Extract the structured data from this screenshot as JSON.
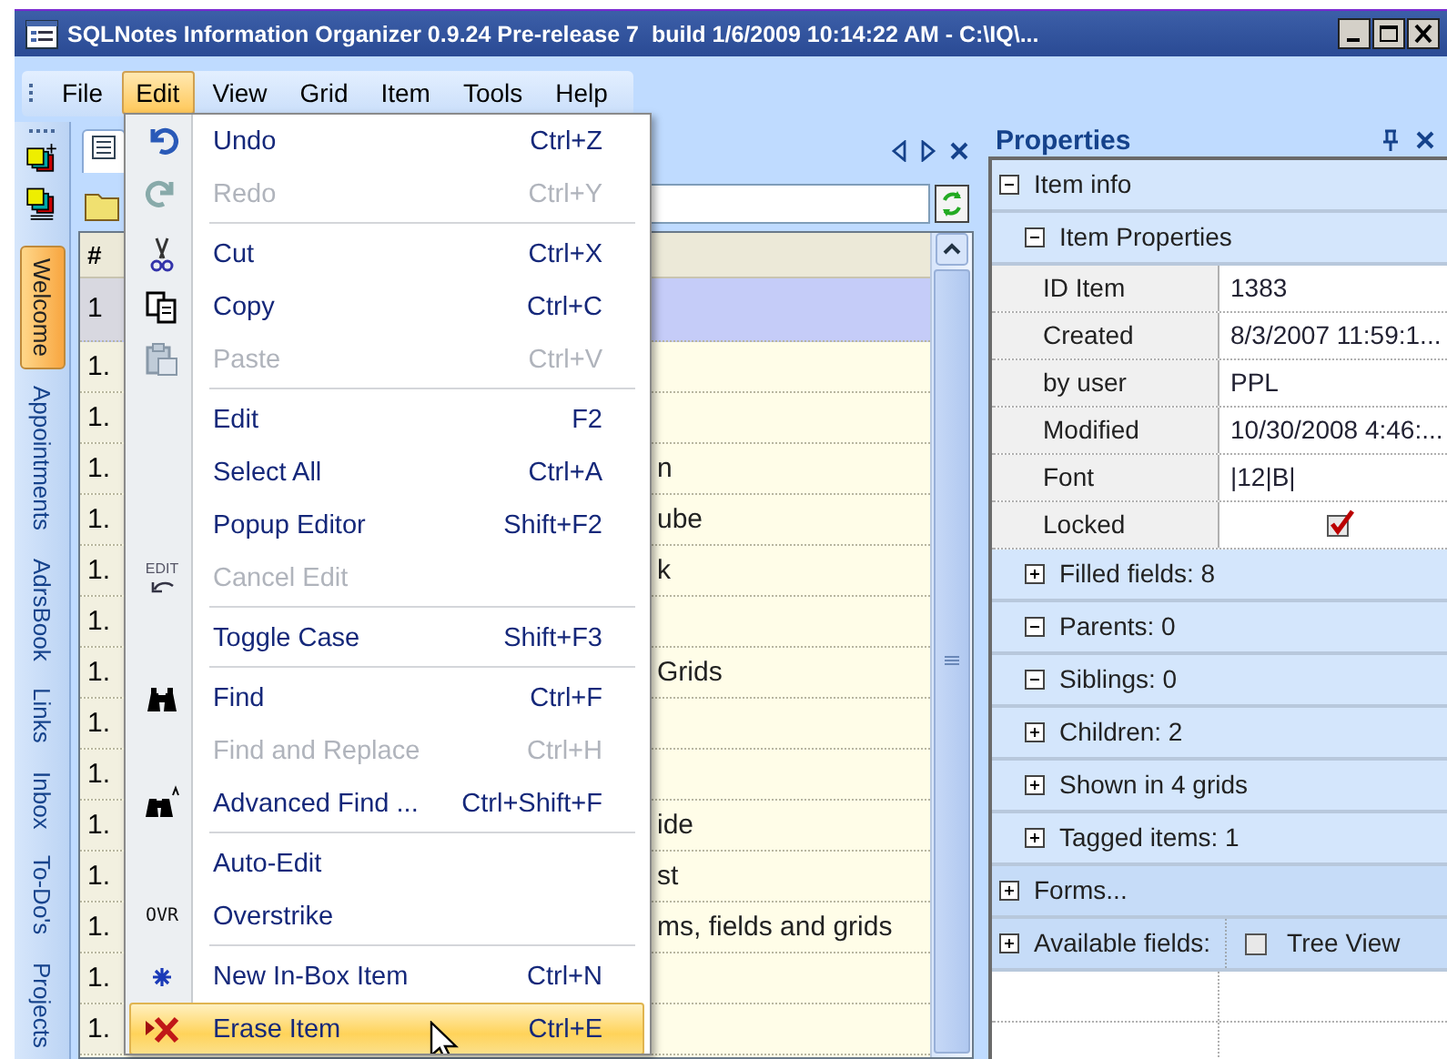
{
  "window": {
    "title": "SQLNotes Information Organizer 0.9.24 Pre-release 7  build 1/6/2009 10:14:22 AM - C:\\IQ\\..."
  },
  "menu_bar": [
    {
      "label": "File",
      "selected": false
    },
    {
      "label": "Edit",
      "selected": true
    },
    {
      "label": "View",
      "selected": false
    },
    {
      "label": "Grid",
      "selected": false
    },
    {
      "label": "Item",
      "selected": false
    },
    {
      "label": "Tools",
      "selected": false
    },
    {
      "label": "Help",
      "selected": false
    }
  ],
  "sidebar": {
    "tabs": [
      {
        "label": "Welcome",
        "selected": true
      },
      {
        "label": "Appointments",
        "selected": false
      },
      {
        "label": "AdrsBook",
        "selected": false
      },
      {
        "label": "Links",
        "selected": false
      },
      {
        "label": "Inbox",
        "selected": false
      },
      {
        "label": "To-Do's",
        "selected": false
      },
      {
        "label": "Projects",
        "selected": false
      }
    ]
  },
  "grid": {
    "columns": [
      "#"
    ],
    "rows": [
      {
        "number": "1",
        "selected": true
      },
      {
        "number": "1.",
        "selected": false
      },
      {
        "number": "1.",
        "selected": false
      },
      {
        "number": "1.",
        "text": "n",
        "selected": false
      },
      {
        "number": "1.",
        "text": "ube",
        "selected": false
      },
      {
        "number": "1.",
        "text": "k",
        "selected": false
      },
      {
        "number": "1.",
        "selected": false
      },
      {
        "number": "1.",
        "text": "Grids",
        "selected": false
      },
      {
        "number": "1.",
        "selected": false
      },
      {
        "number": "1.",
        "selected": false
      },
      {
        "number": "1.",
        "text": "ide",
        "selected": false
      },
      {
        "number": "1.",
        "text": "st",
        "selected": false
      },
      {
        "number": "1.",
        "text": "ms, fields and grids",
        "selected": false
      },
      {
        "number": "1.",
        "selected": false
      },
      {
        "number": "1.",
        "selected": false
      }
    ]
  },
  "edit_menu": {
    "sections": [
      {
        "items": [
          {
            "label": "Undo",
            "shortcut": "Ctrl+Z",
            "disabled": false,
            "selected": false
          },
          {
            "label": "Redo",
            "shortcut": "Ctrl+Y",
            "disabled": true,
            "selected": false
          }
        ]
      },
      {
        "items": [
          {
            "label": "Cut",
            "shortcut": "Ctrl+X",
            "disabled": false,
            "selected": false
          },
          {
            "label": "Copy",
            "shortcut": "Ctrl+C",
            "disabled": false,
            "selected": false
          },
          {
            "label": "Paste",
            "shortcut": "Ctrl+V",
            "disabled": true,
            "selected": false
          }
        ]
      },
      {
        "items": [
          {
            "label": "Edit",
            "shortcut": "F2",
            "disabled": false,
            "selected": false
          },
          {
            "label": "Select All",
            "shortcut": "Ctrl+A",
            "disabled": false,
            "selected": false
          },
          {
            "label": "Popup Editor",
            "shortcut": "Shift+F2",
            "disabled": false,
            "selected": false
          },
          {
            "label": "Cancel Edit",
            "icon_label": "EDIT",
            "disabled": true,
            "selected": false
          }
        ]
      },
      {
        "items": [
          {
            "label": "Toggle Case",
            "shortcut": "Shift+F3",
            "disabled": false,
            "selected": false
          }
        ]
      },
      {
        "items": [
          {
            "label": "Find",
            "shortcut": "Ctrl+F",
            "disabled": false,
            "selected": false
          },
          {
            "label": "Find and Replace",
            "shortcut": "Ctrl+H",
            "disabled": true,
            "selected": false
          },
          {
            "label": "Advanced Find ...",
            "shortcut": "Ctrl+Shift+F",
            "disabled": false,
            "selected": false
          }
        ]
      },
      {
        "items": [
          {
            "label": "Auto-Edit",
            "disabled": false,
            "selected": false
          },
          {
            "label": "Overstrike",
            "icon_label": "OVR",
            "disabled": false,
            "selected": false
          }
        ]
      },
      {
        "items": [
          {
            "label": "New In-Box Item",
            "shortcut": "Ctrl+N",
            "disabled": false,
            "selected": false
          },
          {
            "label": "Erase Item",
            "shortcut": "Ctrl+E",
            "disabled": false,
            "selected": true
          }
        ]
      }
    ]
  },
  "properties": {
    "title": "Properties",
    "tree": [
      {
        "label": "Item info",
        "expanded": true,
        "children": [
          {
            "label": "Item Properties",
            "expanded": true,
            "children": [
              {
                "kind": "property",
                "name": "ID Item",
                "value": "1383"
              },
              {
                "kind": "property",
                "name": "Created",
                "value": "8/3/2007 11:59:1..."
              },
              {
                "kind": "property",
                "name": "by user",
                "value": "PPL"
              },
              {
                "kind": "property",
                "name": "Modified",
                "value": "10/30/2008 4:46:..."
              },
              {
                "kind": "property",
                "name": "Font",
                "value": "|12|B|"
              },
              {
                "kind": "checkbox",
                "name": "Locked",
                "checked": true
              }
            ]
          },
          {
            "label": "Filled fields: 8",
            "expanded": false
          },
          {
            "label": "Parents: 0",
            "expanded": true
          },
          {
            "label": "Siblings: 0",
            "expanded": true
          },
          {
            "label": "Children: 2",
            "expanded": false
          },
          {
            "label": "Shown in 4 grids",
            "expanded": false
          },
          {
            "label": "Tagged items: 1",
            "expanded": false
          }
        ]
      },
      {
        "label": "Forms...",
        "expanded": false
      },
      {
        "label": "Available fields:",
        "expanded": false,
        "option": {
          "label": "Tree View",
          "checked": false
        }
      }
    ]
  }
}
